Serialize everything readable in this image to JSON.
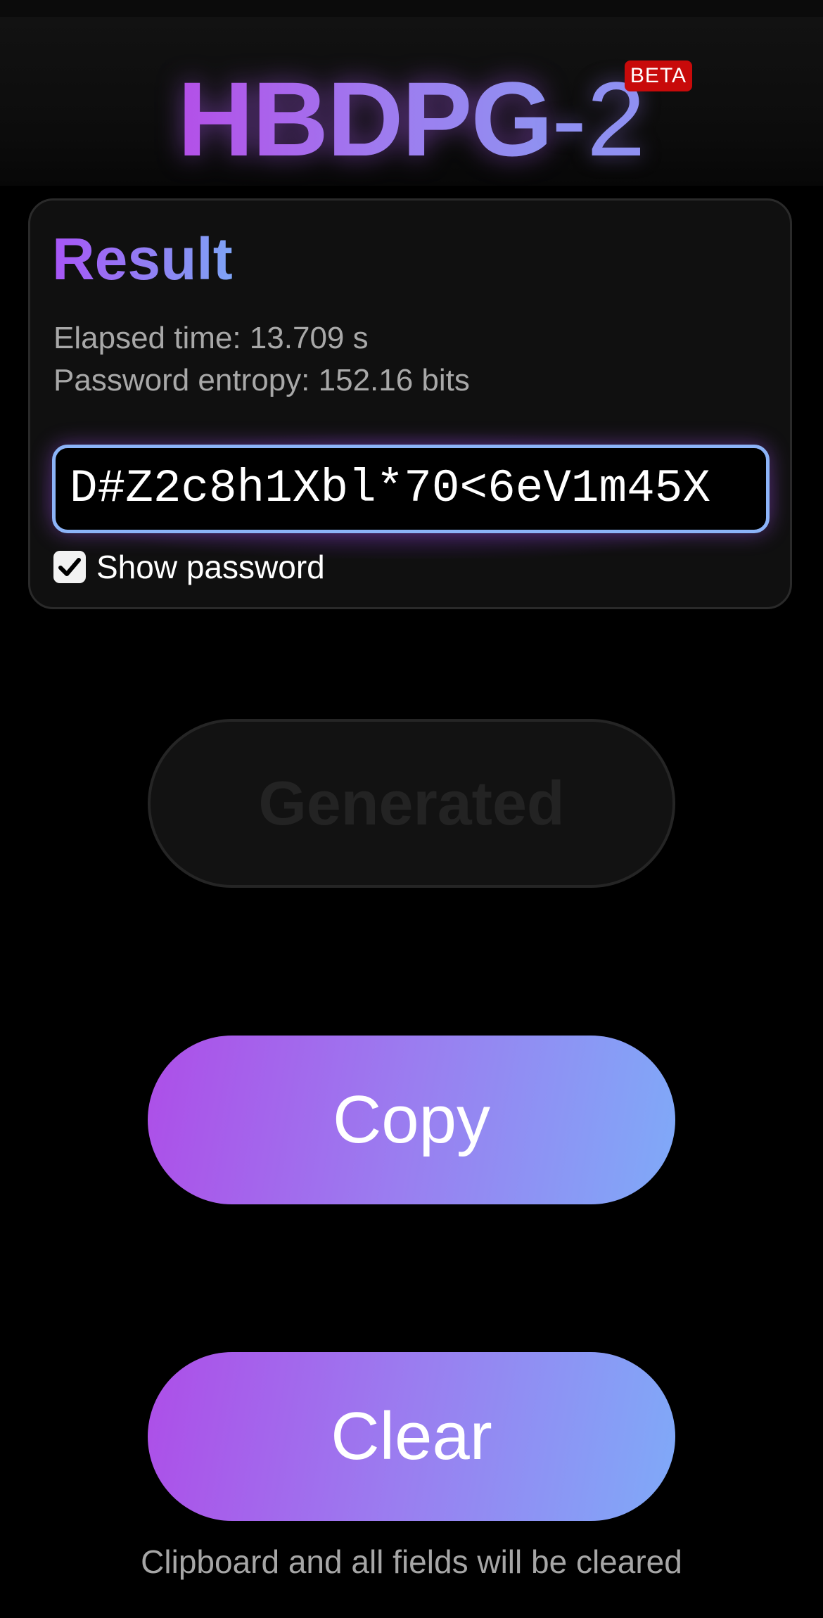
{
  "header": {
    "logo_main": "HBDPG",
    "logo_sub": "-2",
    "badge": "BETA"
  },
  "result": {
    "title": "Result",
    "elapsed": "Elapsed time: 13.709 s",
    "entropy": "Password entropy: 152.16 bits",
    "password": "D#Z2c8h1Xbl*70<6eV1m45X",
    "show_password_label": "Show password",
    "show_password_checked": true
  },
  "actions": {
    "generated_label": "Generated",
    "copy_label": "Copy",
    "clear_label": "Clear",
    "clear_hint": "Clipboard and all fields will be cleared"
  },
  "colors": {
    "accent_purple": "#a855f7",
    "accent_blue": "#7faaf8",
    "badge_red": "#c80a0a",
    "field_border": "#8cb4f8"
  },
  "icons": {
    "checkbox": "check-icon"
  }
}
